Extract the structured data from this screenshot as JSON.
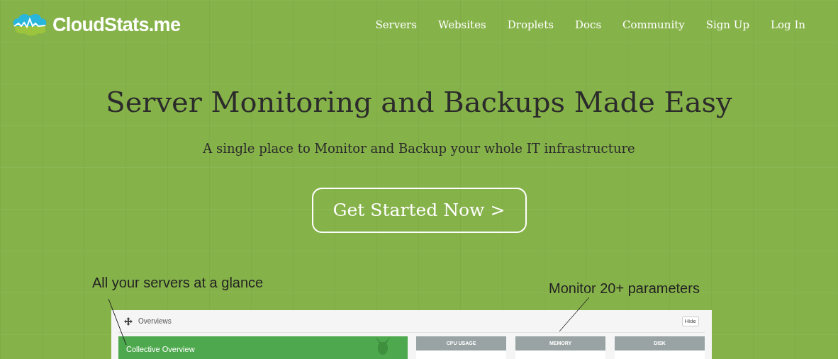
{
  "header": {
    "logo": "CloudStats.me",
    "nav": [
      {
        "label": "Servers"
      },
      {
        "label": "Websites"
      },
      {
        "label": "Droplets"
      },
      {
        "label": "Docs"
      },
      {
        "label": "Community"
      },
      {
        "label": "Sign Up"
      },
      {
        "label": "Log In"
      }
    ]
  },
  "hero": {
    "title": "Server Monitoring and Backups Made Easy",
    "subtitle": "A single place to Monitor and Backup your whole IT infrastructure",
    "cta": "Get Started Now >"
  },
  "annotations": [
    "All your servers at a glance",
    "Monitor 20+ parameters"
  ],
  "dashboard": {
    "title": "Overviews",
    "hide_button": "Hide",
    "overview_card": "Collective Overview",
    "widgets": [
      "CPU USAGE",
      "MEMORY",
      "DISK"
    ]
  }
}
